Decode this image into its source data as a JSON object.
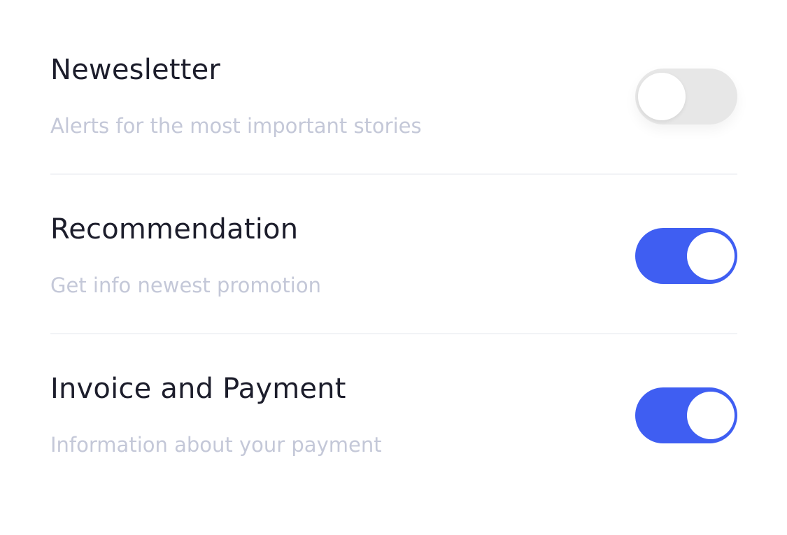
{
  "settings": {
    "items": [
      {
        "title": "Newesletter",
        "description": "Alerts for the most important stories",
        "enabled": false
      },
      {
        "title": "Recommendation",
        "description": "Get info newest promotion",
        "enabled": true
      },
      {
        "title": "Invoice and Payment",
        "description": "Information about your payment",
        "enabled": true
      }
    ]
  },
  "colors": {
    "accent": "#3f5ef2",
    "toggle_off": "#e7e7e7",
    "title_text": "#1c1d2b",
    "description_text": "#c4c8d8"
  }
}
